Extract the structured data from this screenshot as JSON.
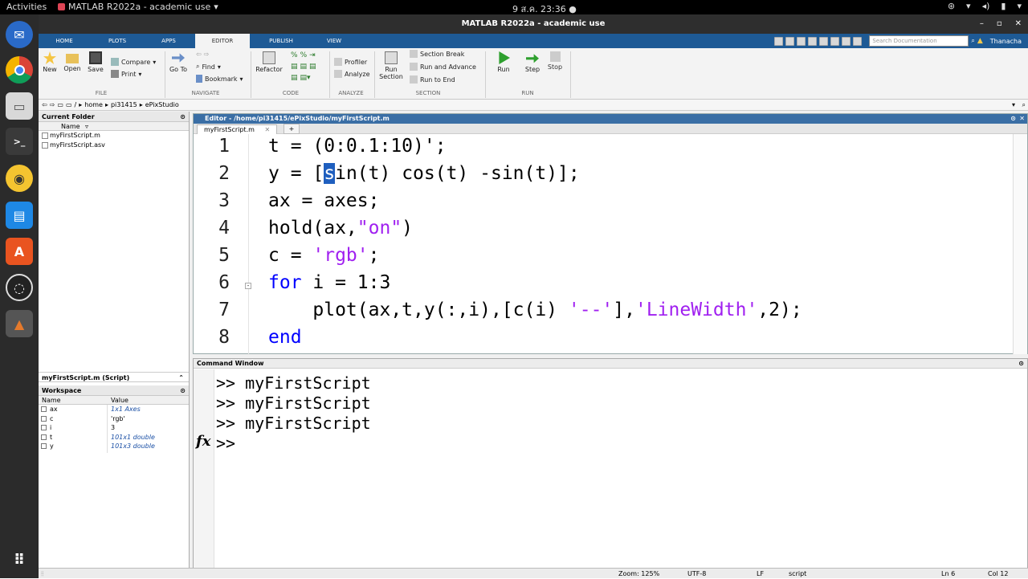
{
  "gnome": {
    "activities": "Activities",
    "app": "MATLAB R2022a - academic use",
    "clock": "9 ส.ค. 23:36"
  },
  "window": {
    "title": "MATLAB R2022a - academic use"
  },
  "ribbon_tabs": [
    "HOME",
    "PLOTS",
    "APPS",
    "EDITOR",
    "PUBLISH",
    "VIEW"
  ],
  "search": {
    "placeholder": "Search Documentation"
  },
  "user": "Thanacha",
  "ribbon": {
    "new": "New",
    "open": "Open",
    "save": "Save",
    "compare": "Compare",
    "print": "Print",
    "goto": "Go To",
    "find": "Find",
    "bookmark": "Bookmark",
    "refactor": "Refactor",
    "profiler": "Profiler",
    "analyze": "Analyze",
    "run_section": "Run Section",
    "section_break": "Section Break",
    "run_advance": "Run and Advance",
    "run_to_end": "Run to End",
    "run": "Run",
    "step": "Step",
    "stop": "Stop",
    "sec_file": "FILE",
    "sec_navigate": "NAVIGATE",
    "sec_code": "CODE",
    "sec_analyze": "ANALYZE",
    "sec_section": "SECTION",
    "sec_run": "RUN"
  },
  "address": [
    "/",
    "home",
    "pi31415",
    "ePixStudio"
  ],
  "current_folder": {
    "title": "Current Folder",
    "col": "Name",
    "files": [
      "myFirstScript.m",
      "myFirstScript.asv"
    ]
  },
  "details": {
    "title": "myFirstScript.m  (Script)"
  },
  "workspace": {
    "title": "Workspace",
    "col_name": "Name",
    "col_value": "Value",
    "vars": [
      {
        "name": "ax",
        "value": "1x1 Axes"
      },
      {
        "name": "c",
        "value": "'rgb'"
      },
      {
        "name": "i",
        "value": "3"
      },
      {
        "name": "t",
        "value": "101x1 double"
      },
      {
        "name": "y",
        "value": "101x3 double"
      }
    ]
  },
  "editor": {
    "title": "Editor - /home/pi31415/ePixStudio/myFirstScript.m",
    "tab": "myFirstScript.m",
    "add": "+"
  },
  "code": {
    "ln": [
      "1",
      "2",
      "3",
      "4",
      "5",
      "6",
      "7",
      "8"
    ],
    "l1": "t = (0:0.1:10)';",
    "l2a": "y = [",
    "l2sel": "s",
    "l2b": "in(t) cos(t) -sin(t)];",
    "l3": "ax = axes;",
    "l4a": "hold(ax,",
    "l4s": "\"on\"",
    "l4b": ")",
    "l5a": "c = ",
    "l5s": "'rgb'",
    "l5b": ";",
    "l6k": "for",
    "l6b": " i = 1:3",
    "l7a": "    plot(ax,t,y(:,i),[c(i) ",
    "l7s1": "'--'",
    "l7b": "],",
    "l7s2": "'LineWidth'",
    "l7c": ",2);",
    "l8k": "end"
  },
  "command": {
    "title": "Command Window",
    "lines": [
      ">> myFirstScript",
      ">> myFirstScript",
      ">> myFirstScript"
    ],
    "prompt": ">>",
    "fx": "fx"
  },
  "status": {
    "zoom": "Zoom: 125%",
    "enc": "UTF-8",
    "eol": "LF",
    "type": "script",
    "ln": "Ln  6",
    "col": "Col  12"
  }
}
